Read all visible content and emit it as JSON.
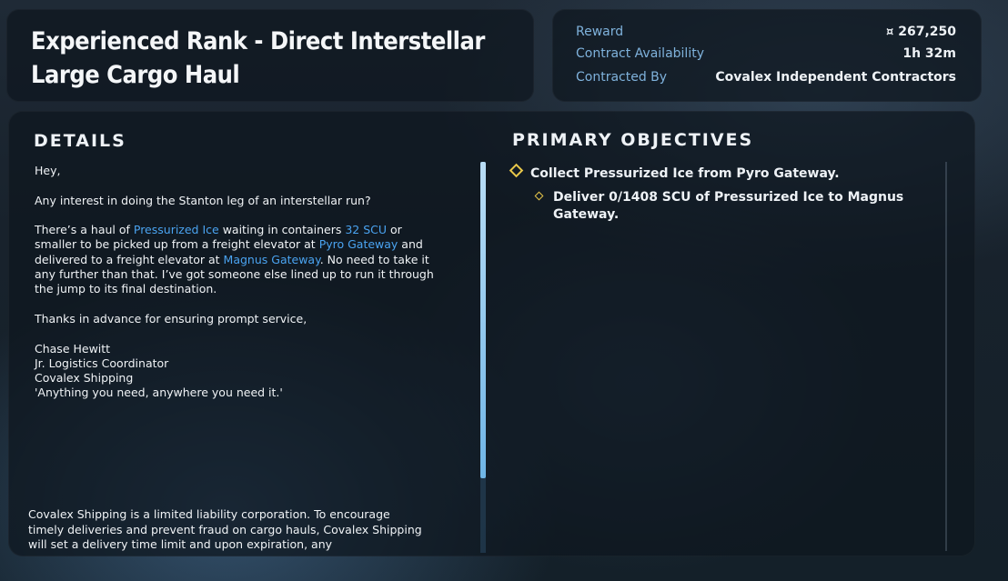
{
  "contract": {
    "title": "Experienced Rank - Direct Interstellar Large Cargo Haul"
  },
  "info": {
    "reward_label": "Reward",
    "reward_value": "267,250",
    "reward_currency_icon": "auec-icon",
    "availability_label": "Contract Availability",
    "availability_value": "1h 32m",
    "contractor_label": "Contracted By",
    "contractor_value": "Covalex Independent Contractors"
  },
  "details": {
    "heading": "DETAILS",
    "greeting": "Hey,",
    "line1": "Any interest in doing the Stanton leg of an interstellar run?",
    "p2_a": "There’s a haul of ",
    "p2_cargo": "Pressurized Ice",
    "p2_b": " waiting in containers ",
    "p2_size": "32 SCU",
    "p2_c": " or smaller to be picked up from a freight elevator at ",
    "p2_pickup": "Pyro Gateway",
    "p2_d": " and delivered to a freight elevator at ",
    "p2_dropoff": "Magnus Gateway",
    "p2_e": ". No need to take it any further than that. I’ve got someone else lined up to run it through the jump to its final destination.",
    "thanks": "Thanks in advance for ensuring prompt service,",
    "sig_name": "Chase Hewitt",
    "sig_role": "Jr. Logistics Coordinator",
    "sig_company": "Covalex Shipping",
    "sig_motto": "'Anything you need, anywhere you need it.'",
    "legal": "Covalex Shipping is a limited liability corporation. To encourage timely deliveries and prevent fraud on cargo hauls, Covalex Shipping will set a delivery time limit and upon expiration, any"
  },
  "objectives": {
    "heading": "PRIMARY OBJECTIVES",
    "items": [
      "Collect Pressurized Ice from Pyro Gateway.",
      "Deliver 0/1408 SCU of Pressurized Ice to Magnus Gateway."
    ]
  },
  "scroll": {
    "thumb_fraction": 0.81
  }
}
